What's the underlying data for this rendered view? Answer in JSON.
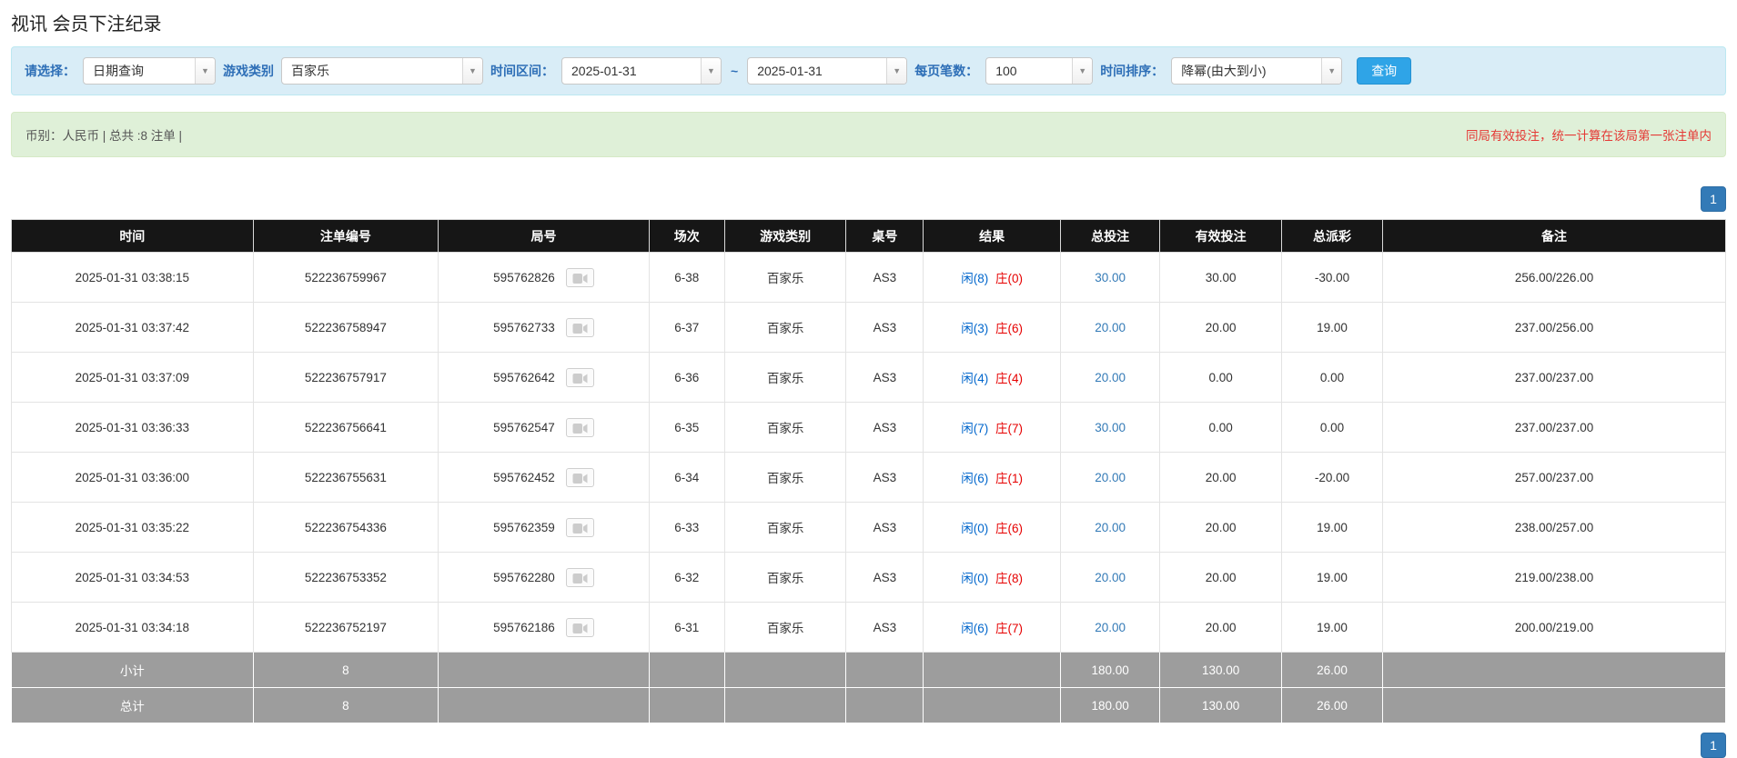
{
  "page": {
    "title": "视讯 会员下注纪录"
  },
  "filters": {
    "select_label": "请选择：",
    "select_value": "日期查询",
    "game_type_label": "游戏类别",
    "game_type_value": "百家乐",
    "time_range_label": "时间区间：",
    "date_from": "2025-01-31",
    "date_separator": "~",
    "date_to": "2025-01-31",
    "page_size_label": "每页笔数：",
    "page_size_value": "100",
    "sort_label": "时间排序：",
    "sort_value": "降幂(由大到小)",
    "search_button": "查询"
  },
  "summary": {
    "left": "币别：人民币 | 总共 :8 注单 |",
    "right": "同局有效投注，统一计算在该局第一张注单内"
  },
  "pagination": {
    "page": "1"
  },
  "icons": {
    "combo_caret": "▼",
    "video_button": "video-icon"
  },
  "colors": {
    "accent_button": "#2fa4e7",
    "pagination_blue": "#337ab7",
    "player_blue": "#0066cc",
    "banker_red": "#e60000",
    "negative_red": "#e60000",
    "link_blue": "#337ab7",
    "filter_bar_bg": "#d9edf7",
    "summary_bar_bg": "#dff0d8",
    "table_header_bg": "#161616",
    "summary_row_bg": "#9d9d9d"
  },
  "table": {
    "headers": [
      "时间",
      "注单编号",
      "局号",
      "场次",
      "游戏类别",
      "桌号",
      "结果",
      "总投注",
      "有效投注",
      "总派彩",
      "备注"
    ],
    "rows": [
      {
        "time": "2025-01-31 03:38:15",
        "bet_id": "522236759967",
        "round": "595762826",
        "session": "6-38",
        "game": "百家乐",
        "table_no": "AS3",
        "result_player": "闲(8)",
        "result_banker": "庄(0)",
        "total_bet": "30.00",
        "valid_bet": "30.00",
        "payout": "-30.00",
        "note": "256.00/226.00"
      },
      {
        "time": "2025-01-31 03:37:42",
        "bet_id": "522236758947",
        "round": "595762733",
        "session": "6-37",
        "game": "百家乐",
        "table_no": "AS3",
        "result_player": "闲(3)",
        "result_banker": "庄(6)",
        "total_bet": "20.00",
        "valid_bet": "20.00",
        "payout": "19.00",
        "note": "237.00/256.00"
      },
      {
        "time": "2025-01-31 03:37:09",
        "bet_id": "522236757917",
        "round": "595762642",
        "session": "6-36",
        "game": "百家乐",
        "table_no": "AS3",
        "result_player": "闲(4)",
        "result_banker": "庄(4)",
        "total_bet": "20.00",
        "valid_bet": "0.00",
        "payout": "0.00",
        "note": "237.00/237.00"
      },
      {
        "time": "2025-01-31 03:36:33",
        "bet_id": "522236756641",
        "round": "595762547",
        "session": "6-35",
        "game": "百家乐",
        "table_no": "AS3",
        "result_player": "闲(7)",
        "result_banker": "庄(7)",
        "total_bet": "30.00",
        "valid_bet": "0.00",
        "payout": "0.00",
        "note": "237.00/237.00"
      },
      {
        "time": "2025-01-31 03:36:00",
        "bet_id": "522236755631",
        "round": "595762452",
        "session": "6-34",
        "game": "百家乐",
        "table_no": "AS3",
        "result_player": "闲(6)",
        "result_banker": "庄(1)",
        "total_bet": "20.00",
        "valid_bet": "20.00",
        "payout": "-20.00",
        "note": "257.00/237.00"
      },
      {
        "time": "2025-01-31 03:35:22",
        "bet_id": "522236754336",
        "round": "595762359",
        "session": "6-33",
        "game": "百家乐",
        "table_no": "AS3",
        "result_player": "闲(0)",
        "result_banker": "庄(6)",
        "total_bet": "20.00",
        "valid_bet": "20.00",
        "payout": "19.00",
        "note": "238.00/257.00"
      },
      {
        "time": "2025-01-31 03:34:53",
        "bet_id": "522236753352",
        "round": "595762280",
        "session": "6-32",
        "game": "百家乐",
        "table_no": "AS3",
        "result_player": "闲(0)",
        "result_banker": "庄(8)",
        "total_bet": "20.00",
        "valid_bet": "20.00",
        "payout": "19.00",
        "note": "219.00/238.00"
      },
      {
        "time": "2025-01-31 03:34:18",
        "bet_id": "522236752197",
        "round": "595762186",
        "session": "6-31",
        "game": "百家乐",
        "table_no": "AS3",
        "result_player": "闲(6)",
        "result_banker": "庄(7)",
        "total_bet": "20.00",
        "valid_bet": "20.00",
        "payout": "19.00",
        "note": "200.00/219.00"
      }
    ],
    "subtotal": {
      "label": "小计",
      "count": "8",
      "total_bet": "180.00",
      "valid_bet": "130.00",
      "payout": "26.00"
    },
    "total": {
      "label": "总计",
      "count": "8",
      "total_bet": "180.00",
      "valid_bet": "130.00",
      "payout": "26.00"
    }
  }
}
